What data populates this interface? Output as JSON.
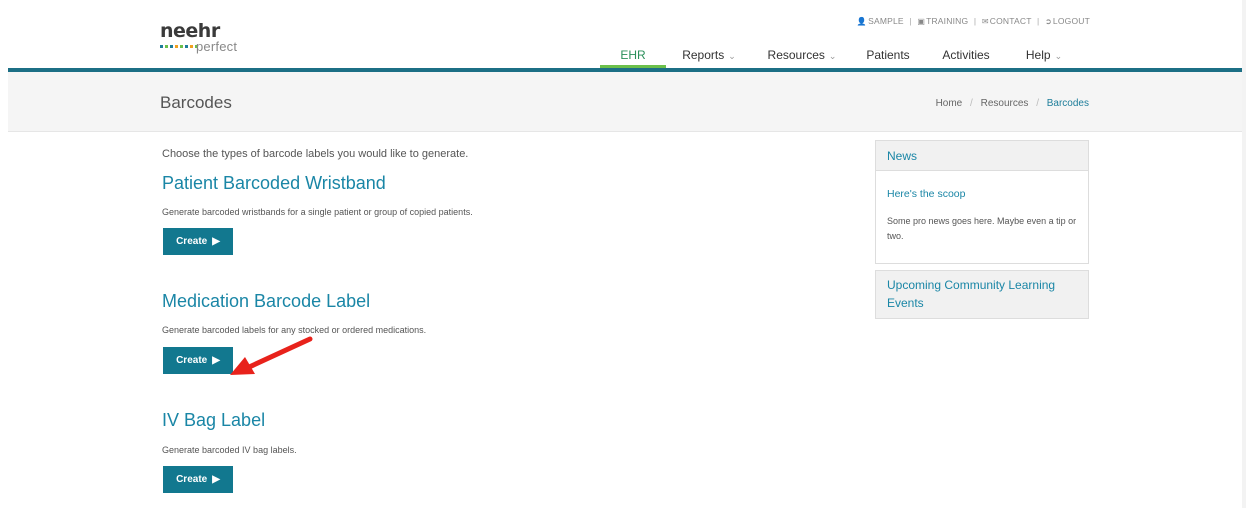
{
  "logo": {
    "main": "neehr",
    "sub": "perfect",
    "dot_colors": [
      "#1d7d9a",
      "#6cc04a",
      "#1d7d9a",
      "#f0a020",
      "#6cc04a",
      "#1d7d9a",
      "#f0a020",
      "#6cc04a"
    ]
  },
  "utility": {
    "sample": "SAMPLE",
    "training": "TRAINING",
    "contact": "CONTACT",
    "logout": "LOGOUT",
    "separator": "|"
  },
  "nav": {
    "ehr": "EHR",
    "reports": "Reports",
    "resources": "Resources",
    "patients": "Patients",
    "activities": "Activities",
    "help": "Help"
  },
  "page": {
    "title": "Barcodes",
    "breadcrumb": {
      "home": "Home",
      "resources": "Resources",
      "current": "Barcodes",
      "separator": "/"
    }
  },
  "main": {
    "intro": "Choose the types of barcode labels you would like to generate.",
    "sections": [
      {
        "title": "Patient Barcoded Wristband",
        "description": "Generate barcoded wristbands for a single patient or group of copied patients.",
        "button": "Create"
      },
      {
        "title": "Medication Barcode Label",
        "description": "Generate barcoded labels for any stocked or ordered medications.",
        "button": "Create"
      },
      {
        "title": "IV Bag Label",
        "description": "Generate barcoded IV bag labels.",
        "button": "Create"
      }
    ]
  },
  "sidebar": {
    "news": {
      "heading": "News",
      "subheading": "Here's the scoop",
      "body": "Some pro news goes here. Maybe even a tip or two."
    },
    "events": {
      "heading": "Upcoming Community Learning Events"
    }
  },
  "colors": {
    "accent": "#1a86a6",
    "button": "#12788f",
    "nav_active": "#6cc04a",
    "rule": "#1c6f85",
    "annotation_arrow": "#e8221b"
  }
}
